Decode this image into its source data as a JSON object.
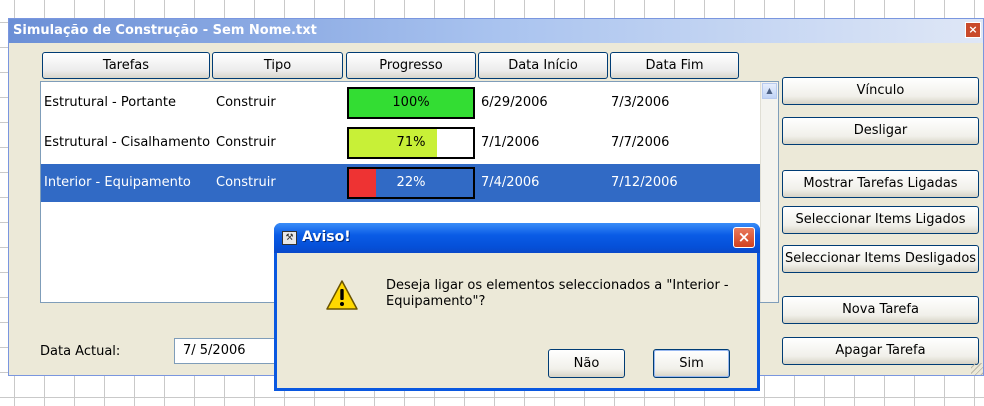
{
  "window": {
    "title": "Simulação de Construção - Sem Nome.txt",
    "close_glyph": "×"
  },
  "columns": [
    "Tarefas",
    "Tipo",
    "Progresso",
    "Data Início",
    "Data Fim"
  ],
  "tasks": [
    {
      "name": "Estrutural - Portante",
      "type": "Construir",
      "progress_label": "100%",
      "progress": 1.0,
      "color": "#33dd33",
      "start": "6/29/2006",
      "end": "7/3/2006",
      "selected": false
    },
    {
      "name": "Estrutural - Cisalhamento",
      "type": "Construir",
      "progress_label": "71%",
      "progress": 0.71,
      "color": "#c8f037",
      "start": "7/1/2006",
      "end": "7/7/2006",
      "selected": false
    },
    {
      "name": "Interior - Equipamento",
      "type": "Construir",
      "progress_label": "22%",
      "progress": 0.22,
      "color": "#ee3333",
      "start": "7/4/2006",
      "end": "7/12/2006",
      "selected": true
    }
  ],
  "side_buttons": {
    "vinculo": "Vínculo",
    "desligar": "Desligar",
    "mostrar": "Mostrar Tarefas Ligadas",
    "sel_ligados": "Seleccionar Items Ligados",
    "sel_desligados": "Seleccionar Items Desligados",
    "nova": "Nova Tarefa",
    "apagar": "Apagar Tarefa"
  },
  "current_date": {
    "label": "Data Actual:",
    "value": "7/ 5/2006"
  },
  "dialog": {
    "title": "Aviso!",
    "message": "Deseja ligar os elementos seleccionados a \"Interior - Equipamento\"?",
    "no": "Não",
    "yes": "Sim",
    "close_glyph": "×"
  },
  "icons": {
    "warning": "warning-icon",
    "title": "app-icon"
  }
}
